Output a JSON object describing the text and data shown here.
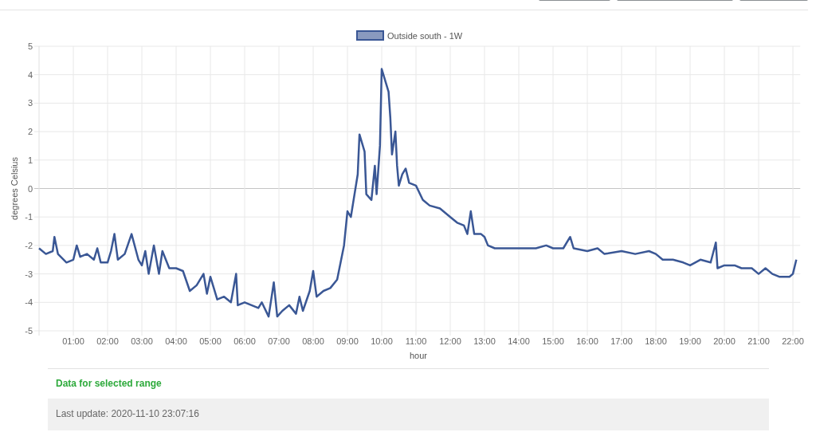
{
  "chart": {
    "chart_data": {
      "type": "line",
      "grid": true,
      "xlabel": "hour",
      "ylabel": "degrees Celsius",
      "x": [
        0,
        0.2,
        0.4,
        0.45,
        0.55,
        0.8,
        1.0,
        1.1,
        1.2,
        1.4,
        1.6,
        1.7,
        1.8,
        2.0,
        2.1,
        2.2,
        2.3,
        2.5,
        2.7,
        2.9,
        3.0,
        3.1,
        3.2,
        3.35,
        3.5,
        3.6,
        3.8,
        4.0,
        4.2,
        4.4,
        4.6,
        4.8,
        4.9,
        5.0,
        5.2,
        5.4,
        5.6,
        5.75,
        5.8,
        6.0,
        6.2,
        6.4,
        6.5,
        6.7,
        6.85,
        6.95,
        7.1,
        7.3,
        7.5,
        7.6,
        7.7,
        7.9,
        8.0,
        8.1,
        8.3,
        8.5,
        8.7,
        8.9,
        9.0,
        9.1,
        9.3,
        9.35,
        9.5,
        9.55,
        9.7,
        9.8,
        9.85,
        9.95,
        10.0,
        10.1,
        10.2,
        10.25,
        10.3,
        10.4,
        10.45,
        10.5,
        10.6,
        10.7,
        10.8,
        11.0,
        11.2,
        11.4,
        11.7,
        12.0,
        12.2,
        12.4,
        12.5,
        12.6,
        12.7,
        12.9,
        13.0,
        13.1,
        13.3,
        13.5,
        14.0,
        14.5,
        14.8,
        15.0,
        15.3,
        15.5,
        15.6,
        16.0,
        16.3,
        16.5,
        17.0,
        17.4,
        17.8,
        18.0,
        18.2,
        18.5,
        18.8,
        19.0,
        19.3,
        19.6,
        19.75,
        19.8,
        20.0,
        20.3,
        20.5,
        20.8,
        21.0,
        21.2,
        21.4,
        21.6,
        21.9,
        22.0,
        22.1
      ],
      "series": [
        {
          "name": "Outside south - 1W",
          "color": "#3a5795",
          "values": [
            -2.1,
            -2.3,
            -2.2,
            -1.7,
            -2.3,
            -2.6,
            -2.5,
            -2.0,
            -2.4,
            -2.3,
            -2.5,
            -2.1,
            -2.6,
            -2.6,
            -2.2,
            -1.6,
            -2.5,
            -2.3,
            -1.6,
            -2.5,
            -2.7,
            -2.2,
            -3.0,
            -2.0,
            -3.0,
            -2.2,
            -2.8,
            -2.8,
            -2.9,
            -3.6,
            -3.4,
            -3.0,
            -3.7,
            -3.1,
            -3.9,
            -3.8,
            -4.0,
            -3.0,
            -4.1,
            -4.0,
            -4.1,
            -4.2,
            -4.0,
            -4.5,
            -3.3,
            -4.5,
            -4.3,
            -4.1,
            -4.4,
            -3.8,
            -4.3,
            -3.6,
            -2.9,
            -3.8,
            -3.6,
            -3.5,
            -3.2,
            -2.0,
            -0.8,
            -1.0,
            0.5,
            1.9,
            1.3,
            -0.2,
            -0.4,
            0.8,
            -0.2,
            1.5,
            4.2,
            3.8,
            3.4,
            2.5,
            1.2,
            2.0,
            0.8,
            0.1,
            0.5,
            0.7,
            0.2,
            0.1,
            -0.4,
            -0.6,
            -0.7,
            -1.0,
            -1.2,
            -1.3,
            -1.6,
            -0.8,
            -1.6,
            -1.6,
            -1.7,
            -2.0,
            -2.1,
            -2.1,
            -2.1,
            -2.1,
            -2.0,
            -2.1,
            -2.1,
            -1.7,
            -2.1,
            -2.2,
            -2.1,
            -2.3,
            -2.2,
            -2.3,
            -2.2,
            -2.3,
            -2.5,
            -2.5,
            -2.6,
            -2.7,
            -2.5,
            -2.6,
            -1.9,
            -2.8,
            -2.7,
            -2.7,
            -2.8,
            -2.8,
            -3.0,
            -2.8,
            -3.0,
            -3.1,
            -3.1,
            -3.0,
            -2.5
          ]
        }
      ],
      "xlim": [
        0,
        22.1
      ],
      "ylim": [
        -5,
        5
      ],
      "xticks": [
        {
          "value": 1,
          "label": "01:00"
        },
        {
          "value": 2,
          "label": "02:00"
        },
        {
          "value": 3,
          "label": "03:00"
        },
        {
          "value": 4,
          "label": "04:00"
        },
        {
          "value": 5,
          "label": "05:00"
        },
        {
          "value": 6,
          "label": "06:00"
        },
        {
          "value": 7,
          "label": "07:00"
        },
        {
          "value": 8,
          "label": "08:00"
        },
        {
          "value": 9,
          "label": "09:00"
        },
        {
          "value": 10,
          "label": "10:00"
        },
        {
          "value": 11,
          "label": "11:00"
        },
        {
          "value": 12,
          "label": "12:00"
        },
        {
          "value": 13,
          "label": "13:00"
        },
        {
          "value": 14,
          "label": "14:00"
        },
        {
          "value": 15,
          "label": "15:00"
        },
        {
          "value": 16,
          "label": "16:00"
        },
        {
          "value": 17,
          "label": "17:00"
        },
        {
          "value": 18,
          "label": "18:00"
        },
        {
          "value": 19,
          "label": "19:00"
        },
        {
          "value": 20,
          "label": "20:00"
        },
        {
          "value": 21,
          "label": "21:00"
        },
        {
          "value": 22,
          "label": "22:00"
        }
      ],
      "yticks": [
        -5,
        -4,
        -3,
        -2,
        -1,
        0,
        1,
        2,
        3,
        4,
        5
      ]
    }
  },
  "range_heading": "Data for selected range",
  "last_update": "Last update: 2020-11-10 23:07:16"
}
